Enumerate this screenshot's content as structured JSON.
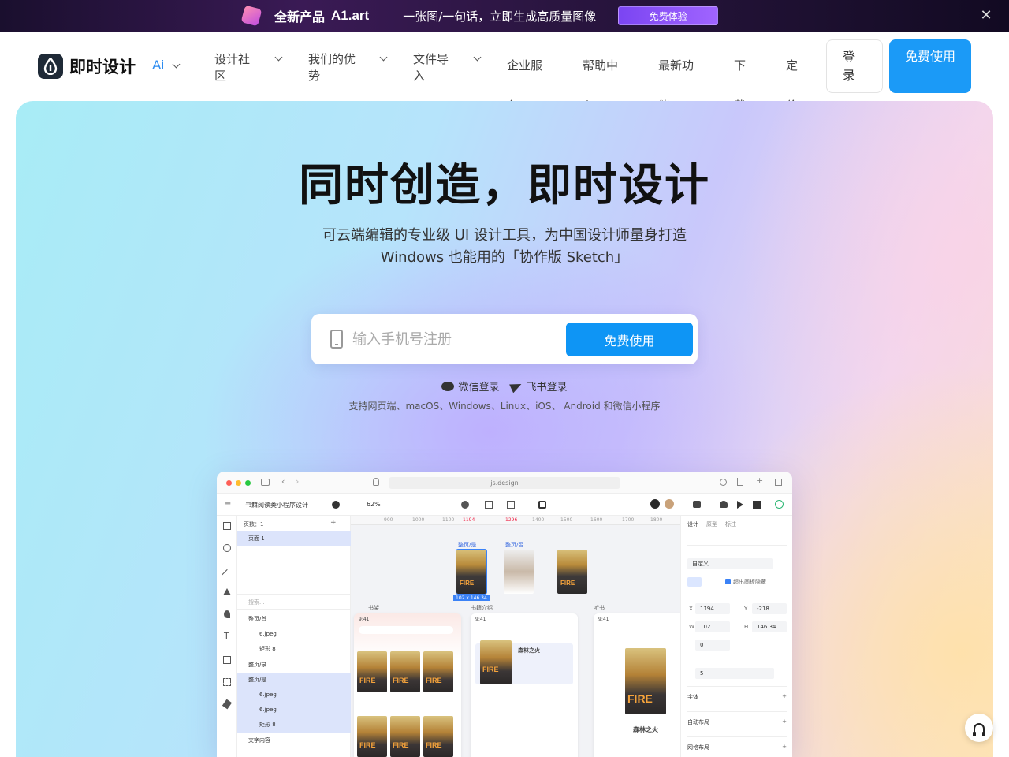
{
  "promo": {
    "title": "全新产品",
    "brand": "A1.art",
    "tagline": "一张图/一句话，立即生成高质量图像",
    "cta": "免费体验",
    "close": "✕"
  },
  "nav": {
    "logo_text": "即时设计",
    "ai_label": "Ai",
    "items": [
      {
        "label": "设计社区"
      },
      {
        "label": "我们的优势"
      },
      {
        "label": "文件导入"
      },
      {
        "label": "企业服务"
      },
      {
        "label": "帮助中心"
      },
      {
        "label": "最新功能"
      },
      {
        "label": "下载"
      },
      {
        "label": "定价"
      }
    ],
    "login": "登录",
    "signup": "免费使用"
  },
  "hero": {
    "title": "同时创造，即时设计",
    "subtitle_1": "可云端编辑的专业级 UI 设计工具，为中国设计师量身打造",
    "subtitle_2": "Windows 也能用的「协作版 Sketch」",
    "phone_placeholder": "输入手机号注册",
    "cta": "免费使用",
    "wechat_login": "微信登录",
    "feishu_login": "飞书登录",
    "platforms": "支持网页端、macOS、Windows、Linux、iOS、 Android 和微信小程序"
  },
  "app": {
    "url": "js.design",
    "project_name": "书籍阅读类小程序设计",
    "zoom": "62%",
    "pages_label": "页数：1",
    "page_1": "页面 1",
    "search_placeholder": "搜索...",
    "layers": [
      "整页/首",
      "6.jpeg",
      "矩形 8",
      "整页/录",
      "整页/是",
      "6.jpeg",
      "6.jpeg",
      "矩形 8",
      "文字内容"
    ],
    "ruler_marks": [
      "900",
      "1000",
      "1100",
      "1194",
      "1296",
      "1400",
      "1500",
      "1600",
      "1700",
      "1800"
    ],
    "frame_labels": [
      "整页/是",
      "整页/否"
    ],
    "selection_size": "102 x 146.34",
    "phone_labels": [
      "书架",
      "书籍介绍",
      "听书"
    ],
    "phone_time": "9:41",
    "book_cover_text": "FIRE",
    "book_title": "森林之火",
    "panel_tabs": [
      "设计",
      "原型",
      "标注"
    ],
    "constraint": "自定义",
    "clip_label": "超出画板隐藏",
    "x_label": "X",
    "x_value": "1194",
    "y_label": "Y",
    "y_value": "-218",
    "w_label": "W",
    "w_value": "102",
    "h_label": "H",
    "h_value": "146.34",
    "rotation": "0",
    "radius": "5",
    "sections": [
      "字体",
      "自动布局",
      "网格布局"
    ],
    "plus": "+"
  },
  "colors": {
    "brand_blue": "#1b9af7",
    "promo_bg": "#2a1540",
    "promo_button": "#7b45f2"
  }
}
